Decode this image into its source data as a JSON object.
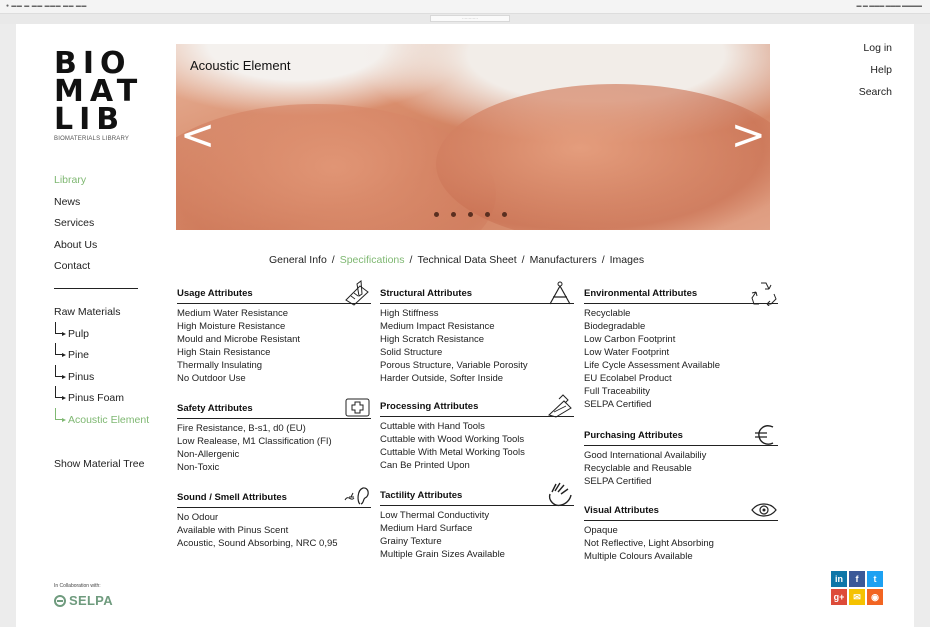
{
  "logo": {
    "line1": "BIO",
    "line2": "MAT",
    "line3": "LIB",
    "subtitle": "BIOMATERIALS LIBRARY"
  },
  "nav": [
    "Library",
    "News",
    "Services",
    "About Us",
    "Contact"
  ],
  "sub_nav": {
    "root": "Raw Materials",
    "children": [
      "Pulp",
      "Pine",
      "Pinus",
      "Pinus Foam",
      "Acoustic Element"
    ]
  },
  "show_tree": "Show Material Tree",
  "hero": {
    "title": "Acoustic Element",
    "prev": "<",
    "next": ">",
    "slide_count": 5
  },
  "top_links": [
    "Log in",
    "Help",
    "Search"
  ],
  "breadcrumb": [
    "General Info",
    "Specifications",
    "Technical Data Sheet",
    "Manufacturers",
    "Images"
  ],
  "separator": "/",
  "groups": {
    "usage": {
      "title": "Usage Attributes",
      "icon": "ruler-pencil-icon",
      "lines": [
        "Medium Water Resistance",
        "High Moisture Resistance",
        "Mould and Microbe Resistant",
        "High Stain Resistance",
        "Thermally Insulating",
        "No Outdoor Use"
      ]
    },
    "safety": {
      "title": "Safety Attributes",
      "icon": "first-aid-icon",
      "lines": [
        "Fire Resistance, B-s1, d0 (EU)",
        "Low Realease, M1 Classification (FI)",
        "Non-Allergenic",
        "Non-Toxic"
      ]
    },
    "sound": {
      "title": "Sound / Smell Attributes",
      "icon": "ear-nose-icon",
      "lines": [
        "No Odour",
        "Available with Pinus Scent",
        "Acoustic, Sound Absorbing, NRC 0,95"
      ]
    },
    "structural": {
      "title": "Structural Attributes",
      "icon": "compass-icon",
      "lines": [
        "High Stiffness",
        "Medium Impact Resistance",
        "High Scratch Resistance",
        "Solid Structure",
        "Porous Structure, Variable Porosity",
        "Harder Outside, Softer Inside"
      ]
    },
    "processing": {
      "title": "Processing Attributes",
      "icon": "saw-icon",
      "lines": [
        "Cuttable with Hand Tools",
        "Cuttable with Wood Working Tools",
        "Cuttable With Metal Working Tools",
        "Can Be Printed Upon"
      ]
    },
    "tactility": {
      "title": "Tactility Attributes",
      "icon": "hand-icon",
      "lines": [
        "Low Thermal Conductivity",
        "Medium Hard Surface",
        "Grainy Texture",
        "Multiple Grain Sizes Available"
      ]
    },
    "environmental": {
      "title": "Environmental Attributes",
      "icon": "recycle-icon",
      "lines": [
        "Recyclable",
        "Biodegradable",
        "Low Carbon Footprint",
        "Low Water Footprint",
        "Life Cycle Assessment Available",
        "EU Ecolabel Product",
        "Full Traceability",
        "SELPA Certified"
      ]
    },
    "purchasing": {
      "title": "Purchasing Attributes",
      "icon": "euro-icon",
      "lines": [
        "Good International Availabiliy",
        "Recyclable and Reusable",
        "SELPA Certified"
      ]
    },
    "visual": {
      "title": "Visual Attributes",
      "icon": "eye-icon",
      "lines": [
        "Opaque",
        "Not Reflective, Light Absorbing",
        "Multiple Colours Available"
      ]
    }
  },
  "collab": {
    "label": "In Collaboration with:",
    "partner": "SELPA"
  },
  "social": [
    {
      "name": "linkedin",
      "glyph": "in",
      "color": "#0e76a8"
    },
    {
      "name": "facebook",
      "glyph": "f",
      "color": "#3b5998"
    },
    {
      "name": "twitter",
      "glyph": "t",
      "color": "#1da1f2"
    },
    {
      "name": "google-plus",
      "glyph": "g+",
      "color": "#dd4b39"
    },
    {
      "name": "email",
      "glyph": "✉",
      "color": "#f5c200"
    },
    {
      "name": "rss",
      "glyph": "◉",
      "color": "#f26522"
    }
  ]
}
